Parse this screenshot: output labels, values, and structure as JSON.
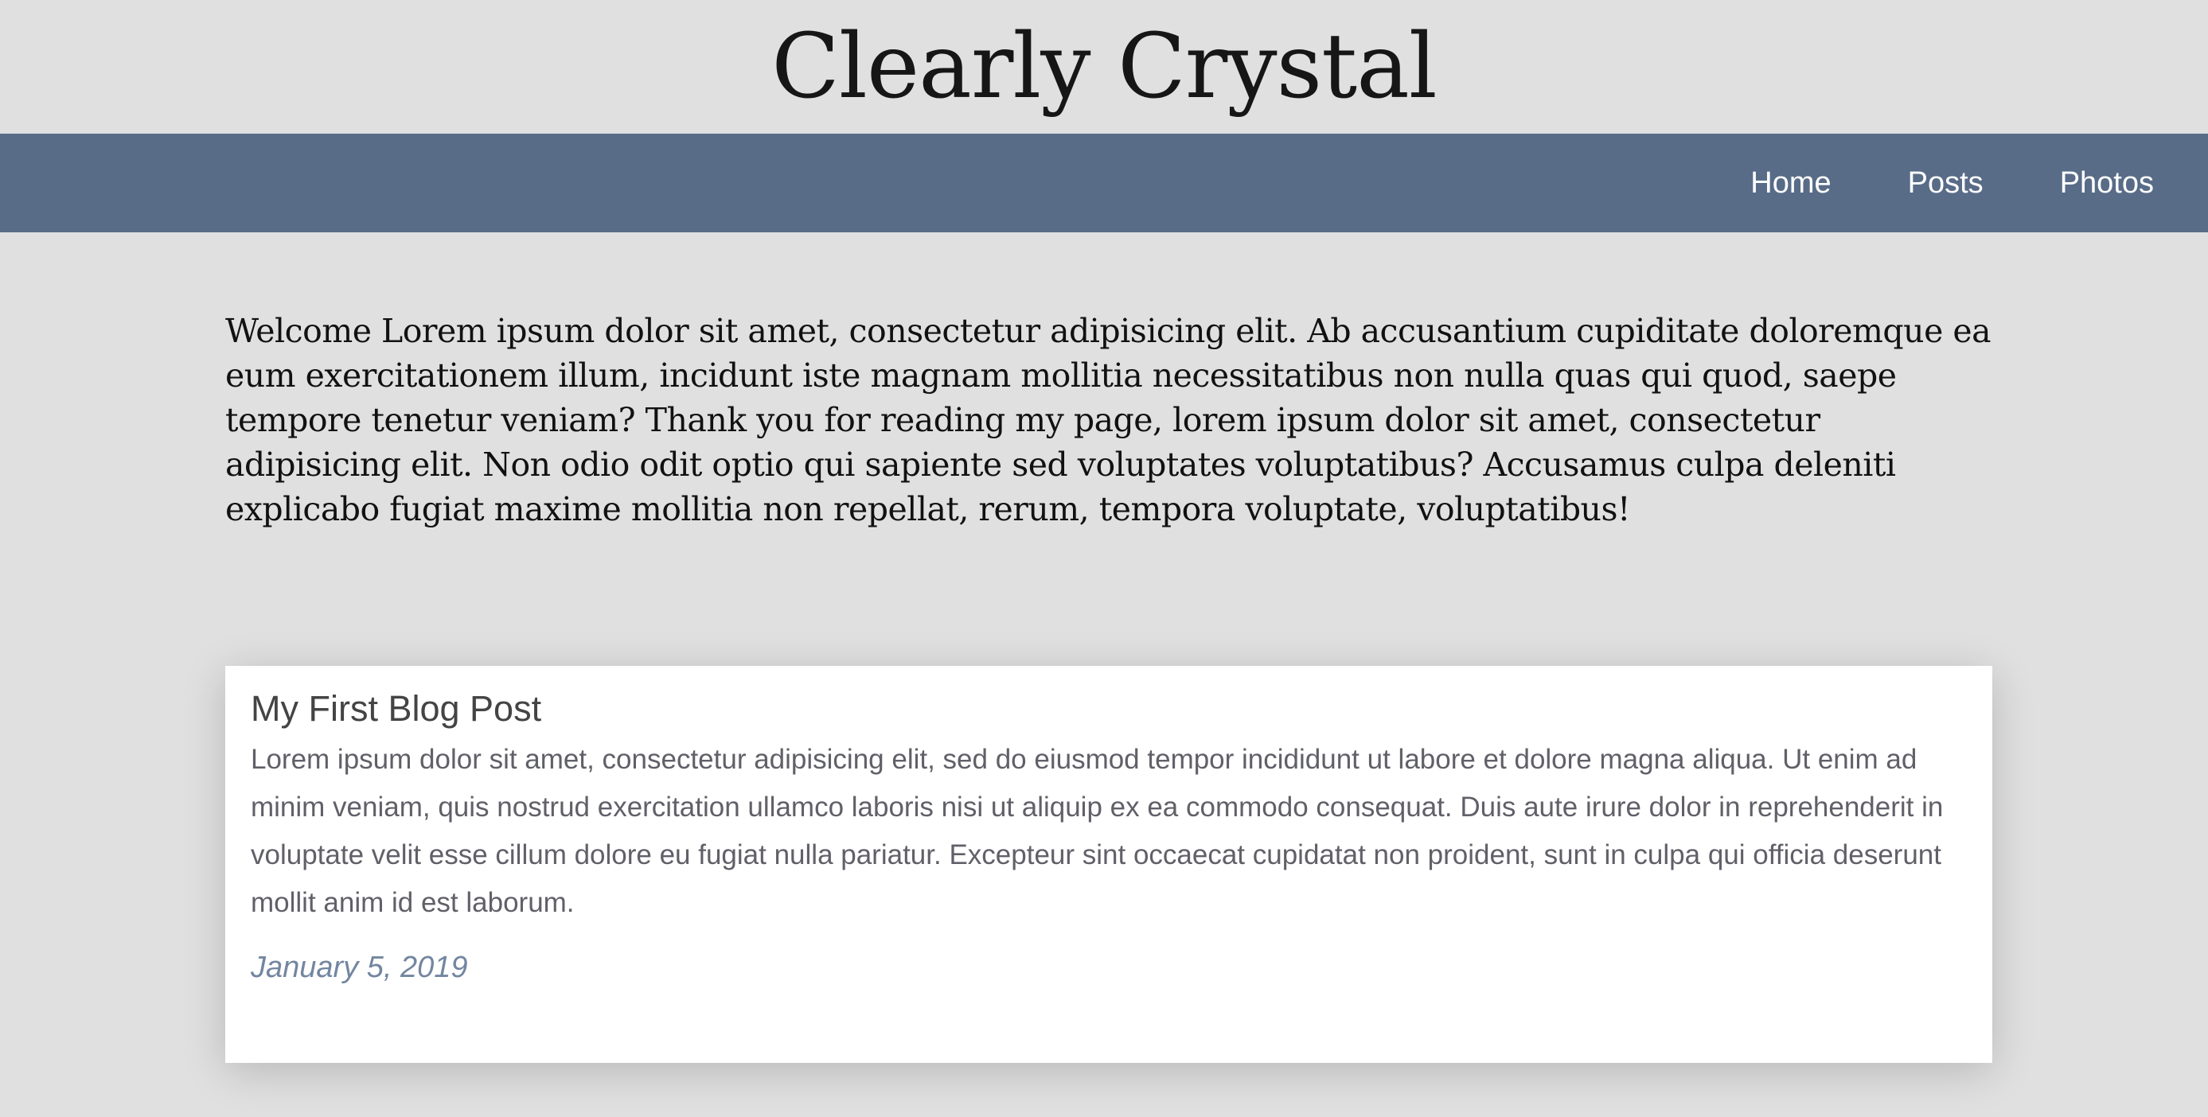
{
  "header": {
    "title": "Clearly Crystal"
  },
  "nav": {
    "items": [
      {
        "label": "Home"
      },
      {
        "label": "Posts"
      },
      {
        "label": "Photos"
      }
    ],
    "background": "#586c88"
  },
  "intro": {
    "text": "Welcome Lorem ipsum dolor sit amet, consectetur adipisicing elit. Ab accusantium cupiditate doloremque ea eum exercitationem illum, incidunt iste magnam mollitia necessitatibus non nulla quas qui quod, saepe tempore tenetur veniam? Thank you for reading my page, lorem ipsum dolor sit amet, consectetur adipisicing elit. Non odio odit optio qui sapiente sed voluptates voluptatibus? Accusamus culpa deleniti explicabo fugiat maxime mollitia non repellat, rerum, tempora voluptate, voluptatibus!"
  },
  "posts": [
    {
      "title": "My First Blog Post",
      "body": "Lorem ipsum dolor sit amet, consectetur adipisicing elit, sed do eiusmod tempor incididunt ut labore et dolore magna aliqua. Ut enim ad minim veniam, quis nostrud exercitation ullamco laboris nisi ut aliquip ex ea commodo consequat. Duis aute irure dolor in reprehenderit in voluptate velit esse cillum dolore eu fugiat nulla pariatur. Excepteur sint occaecat cupidatat non proident, sunt in culpa qui officia deserunt mollit anim id est laborum.",
      "date": "January 5, 2019"
    }
  ]
}
